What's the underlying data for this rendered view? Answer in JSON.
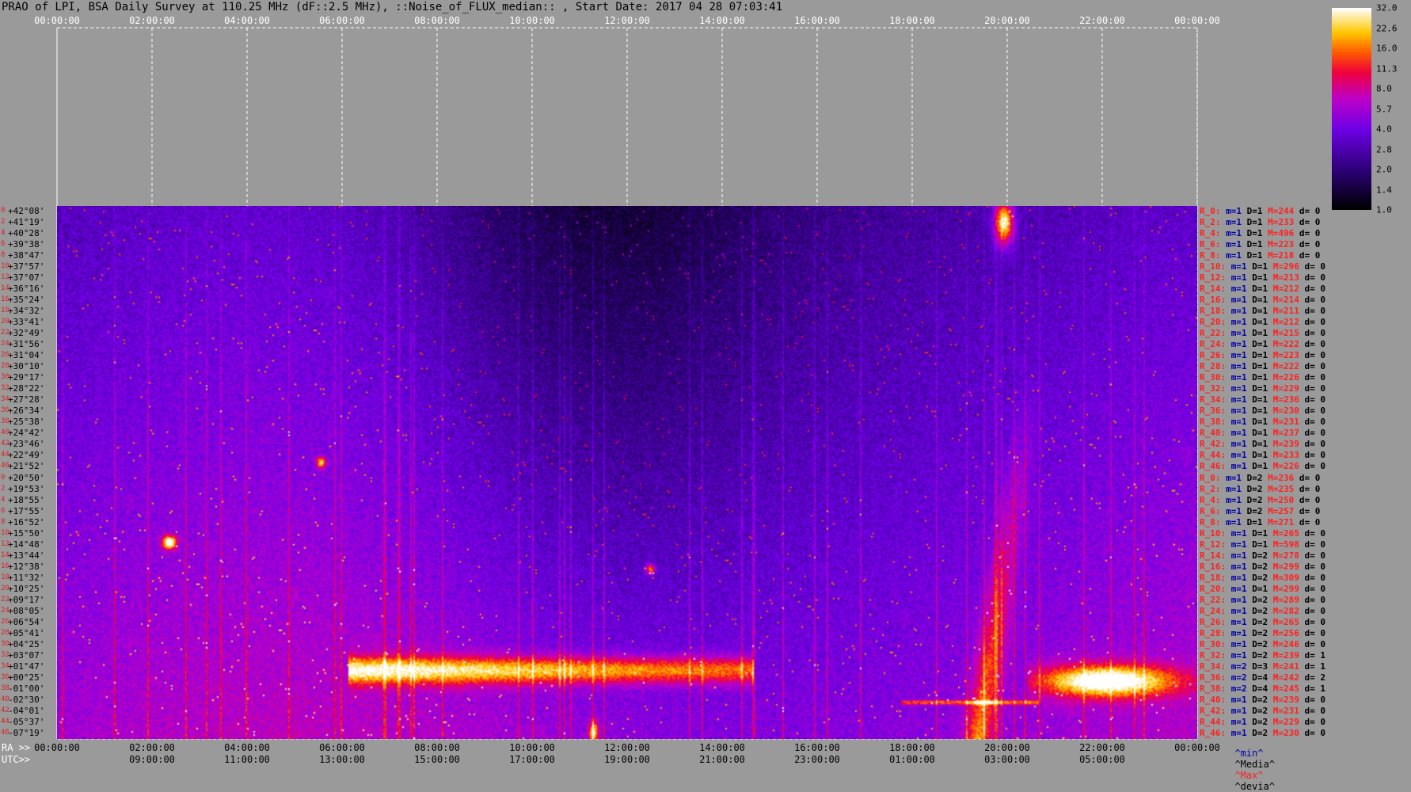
{
  "title": "PRAO of LPI, BSA Daily Survey at 110.25 MHz (dF::2.5 MHz), ::Noise_of_FLUX_median:: , Start Date: 2017 04 28 07:03:41",
  "axis": {
    "top_ticks": [
      "00:00:00",
      "02:00:00",
      "04:00:00",
      "06:00:00",
      "08:00:00",
      "10:00:00",
      "12:00:00",
      "14:00:00",
      "16:00:00",
      "18:00:00",
      "20:00:00",
      "22:00:00",
      "00:00:00"
    ],
    "ra_label": "RA >>",
    "ra_ticks": [
      "00:00:00",
      "02:00:00",
      "04:00:00",
      "06:00:00",
      "08:00:00",
      "10:00:00",
      "12:00:00",
      "14:00:00",
      "16:00:00",
      "18:00:00",
      "20:00:00",
      "22:00:00",
      "00:00:00"
    ],
    "utc_label": "UTC>>",
    "utc_ticks": [
      "09:00:00",
      "11:00:00",
      "13:00:00",
      "15:00:00",
      "17:00:00",
      "19:00:00",
      "21:00:00",
      "23:00:00",
      "01:00:00",
      "03:00:00",
      "05:00:00"
    ]
  },
  "colorbar": {
    "labels": [
      "32.0",
      "22.6",
      "16.0",
      "11.3",
      "8.0",
      "5.7",
      "4.0",
      "2.8",
      "2.0",
      "1.4",
      "1.0"
    ]
  },
  "footer_legend": {
    "min": "^min^",
    "media": "^Media^",
    "max": "^Max^",
    "devia": "^devia^"
  },
  "chart_data": {
    "type": "heatmap",
    "title": "PRAO of LPI, BSA Daily Survey at 110.25 MHz (dF::2.5 MHz), ::Noise_of_FLUX_median:: , Start Date: 2017 04 28 07:03:41",
    "x_axis": "RA / UTC",
    "scale": "log",
    "vmin": 1.0,
    "vmax": 32.0,
    "declinations": [
      "+42°08'",
      "+41°19'",
      "+40°28'",
      "+39°38'",
      "+38°47'",
      "+37°57'",
      "+37°07'",
      "+36°16'",
      "+35°24'",
      "+34°32'",
      "+33°41'",
      "+32°49'",
      "+31°56'",
      "+31°04'",
      "+30°10'",
      "+29°17'",
      "+28°22'",
      "+27°28'",
      "+26°34'",
      "+25°38'",
      "+24°42'",
      "+23°46'",
      "+22°49'",
      "+21°52'",
      "+20°50'",
      "+19°53'",
      "+18°55'",
      "+17°55'",
      "+16°52'",
      "+15°50'",
      "+14°48'",
      "+13°44'",
      "+12°38'",
      "+11°32'",
      "+10°25'",
      "+09°17'",
      "+08°05'",
      "+06°54'",
      "+05°41'",
      "+04°25'",
      "+03°07'",
      "+01°47'",
      "+00°25'",
      "-01°00'",
      "-02°30'",
      "-04°01'",
      "-05°37'",
      "-07°19'"
    ],
    "row_index_labels": [
      "0",
      "2",
      "4",
      "6",
      "8",
      "10",
      "12",
      "14",
      "16",
      "18",
      "20",
      "22",
      "24",
      "26",
      "28",
      "30",
      "32",
      "34",
      "36",
      "38",
      "40",
      "42",
      "44",
      "46",
      "0",
      "2",
      "4",
      "6",
      "8",
      "10",
      "12",
      "14",
      "16",
      "18",
      "20",
      "22",
      "24",
      "26",
      "28",
      "30",
      "32",
      "34",
      "36",
      "38",
      "40",
      "42",
      "44",
      "46"
    ],
    "rows": [
      {
        "r": "R_0:",
        "m": "m=1",
        "d": "D=1",
        "M": "M=244",
        "dv": "d= 0"
      },
      {
        "r": "R_2:",
        "m": "m=1",
        "d": "D=1",
        "M": "M=233",
        "dv": "d= 0"
      },
      {
        "r": "R_4:",
        "m": "m=1",
        "d": "D=1",
        "M": "M=496",
        "dv": "d= 0"
      },
      {
        "r": "R_6:",
        "m": "m=1",
        "d": "D=1",
        "M": "M=223",
        "dv": "d= 0"
      },
      {
        "r": "R_8:",
        "m": "m=1",
        "d": "D=1",
        "M": "M=218",
        "dv": "d= 0"
      },
      {
        "r": "R_10:",
        "m": "m=1",
        "d": "D=1",
        "M": "M=296",
        "dv": "d= 0"
      },
      {
        "r": "R_12:",
        "m": "m=1",
        "d": "D=1",
        "M": "M=213",
        "dv": "d= 0"
      },
      {
        "r": "R_14:",
        "m": "m=1",
        "d": "D=1",
        "M": "M=212",
        "dv": "d= 0"
      },
      {
        "r": "R_16:",
        "m": "m=1",
        "d": "D=1",
        "M": "M=214",
        "dv": "d= 0"
      },
      {
        "r": "R_18:",
        "m": "m=1",
        "d": "D=1",
        "M": "M=211",
        "dv": "d= 0"
      },
      {
        "r": "R_20:",
        "m": "m=1",
        "d": "D=1",
        "M": "M=212",
        "dv": "d= 0"
      },
      {
        "r": "R_22:",
        "m": "m=1",
        "d": "D=1",
        "M": "M=215",
        "dv": "d= 0"
      },
      {
        "r": "R_24:",
        "m": "m=1",
        "d": "D=1",
        "M": "M=222",
        "dv": "d= 0"
      },
      {
        "r": "R_26:",
        "m": "m=1",
        "d": "D=1",
        "M": "M=223",
        "dv": "d= 0"
      },
      {
        "r": "R_28:",
        "m": "m=1",
        "d": "D=1",
        "M": "M=222",
        "dv": "d= 0"
      },
      {
        "r": "R_30:",
        "m": "m=1",
        "d": "D=1",
        "M": "M=226",
        "dv": "d= 0"
      },
      {
        "r": "R_32:",
        "m": "m=1",
        "d": "D=1",
        "M": "M=229",
        "dv": "d= 0"
      },
      {
        "r": "R_34:",
        "m": "m=1",
        "d": "D=1",
        "M": "M=236",
        "dv": "d= 0"
      },
      {
        "r": "R_36:",
        "m": "m=1",
        "d": "D=1",
        "M": "M=230",
        "dv": "d= 0"
      },
      {
        "r": "R_38:",
        "m": "m=1",
        "d": "D=1",
        "M": "M=231",
        "dv": "d= 0"
      },
      {
        "r": "R_40:",
        "m": "m=1",
        "d": "D=1",
        "M": "M=237",
        "dv": "d= 0"
      },
      {
        "r": "R_42:",
        "m": "m=1",
        "d": "D=1",
        "M": "M=239",
        "dv": "d= 0"
      },
      {
        "r": "R_44:",
        "m": "m=1",
        "d": "D=1",
        "M": "M=233",
        "dv": "d= 0"
      },
      {
        "r": "R_46:",
        "m": "m=1",
        "d": "D=1",
        "M": "M=226",
        "dv": "d= 0"
      },
      {
        "r": "R_0:",
        "m": "m=1",
        "d": "D=2",
        "M": "M=236",
        "dv": "d= 0"
      },
      {
        "r": "R_2:",
        "m": "m=1",
        "d": "D=2",
        "M": "M=235",
        "dv": "d= 0"
      },
      {
        "r": "R_4:",
        "m": "m=1",
        "d": "D=2",
        "M": "M=250",
        "dv": "d= 0"
      },
      {
        "r": "R_6:",
        "m": "m=1",
        "d": "D=2",
        "M": "M=257",
        "dv": "d= 0"
      },
      {
        "r": "R_8:",
        "m": "m=1",
        "d": "D=1",
        "M": "M=271",
        "dv": "d= 0"
      },
      {
        "r": "R_10:",
        "m": "m=1",
        "d": "D=1",
        "M": "M=265",
        "dv": "d= 0"
      },
      {
        "r": "R_12:",
        "m": "m=1",
        "d": "D=1",
        "M": "M=598",
        "dv": "d= 0"
      },
      {
        "r": "R_14:",
        "m": "m=1",
        "d": "D=2",
        "M": "M=278",
        "dv": "d= 0"
      },
      {
        "r": "R_16:",
        "m": "m=1",
        "d": "D=2",
        "M": "M=299",
        "dv": "d= 0"
      },
      {
        "r": "R_18:",
        "m": "m=1",
        "d": "D=2",
        "M": "M=309",
        "dv": "d= 0"
      },
      {
        "r": "R_20:",
        "m": "m=1",
        "d": "D=1",
        "M": "M=299",
        "dv": "d= 0"
      },
      {
        "r": "R_22:",
        "m": "m=1",
        "d": "D=2",
        "M": "M=289",
        "dv": "d= 0"
      },
      {
        "r": "R_24:",
        "m": "m=1",
        "d": "D=2",
        "M": "M=282",
        "dv": "d= 0"
      },
      {
        "r": "R_26:",
        "m": "m=1",
        "d": "D=2",
        "M": "M=265",
        "dv": "d= 0"
      },
      {
        "r": "R_28:",
        "m": "m=1",
        "d": "D=2",
        "M": "M=256",
        "dv": "d= 0"
      },
      {
        "r": "R_30:",
        "m": "m=1",
        "d": "D=2",
        "M": "M=246",
        "dv": "d= 0"
      },
      {
        "r": "R_32:",
        "m": "m=1",
        "d": "D=2",
        "M": "M=239",
        "dv": "d= 1"
      },
      {
        "r": "R_34:",
        "m": "m=2",
        "d": "D=3",
        "M": "M=241",
        "dv": "d= 1"
      },
      {
        "r": "R_36:",
        "m": "m=2",
        "d": "D=4",
        "M": "M=242",
        "dv": "d= 2"
      },
      {
        "r": "R_38:",
        "m": "m=2",
        "d": "D=4",
        "M": "M=245",
        "dv": "d= 1"
      },
      {
        "r": "R_40:",
        "m": "m=1",
        "d": "D=2",
        "M": "M=239",
        "dv": "d= 0"
      },
      {
        "r": "R_42:",
        "m": "m=1",
        "d": "D=2",
        "M": "M=231",
        "dv": "d= 0"
      },
      {
        "r": "R_44:",
        "m": "m=1",
        "d": "D=2",
        "M": "M=229",
        "dv": "d= 0"
      },
      {
        "r": "R_46:",
        "m": "m=1",
        "d": "D=2",
        "M": "M=230",
        "dv": "d= 0"
      }
    ]
  }
}
